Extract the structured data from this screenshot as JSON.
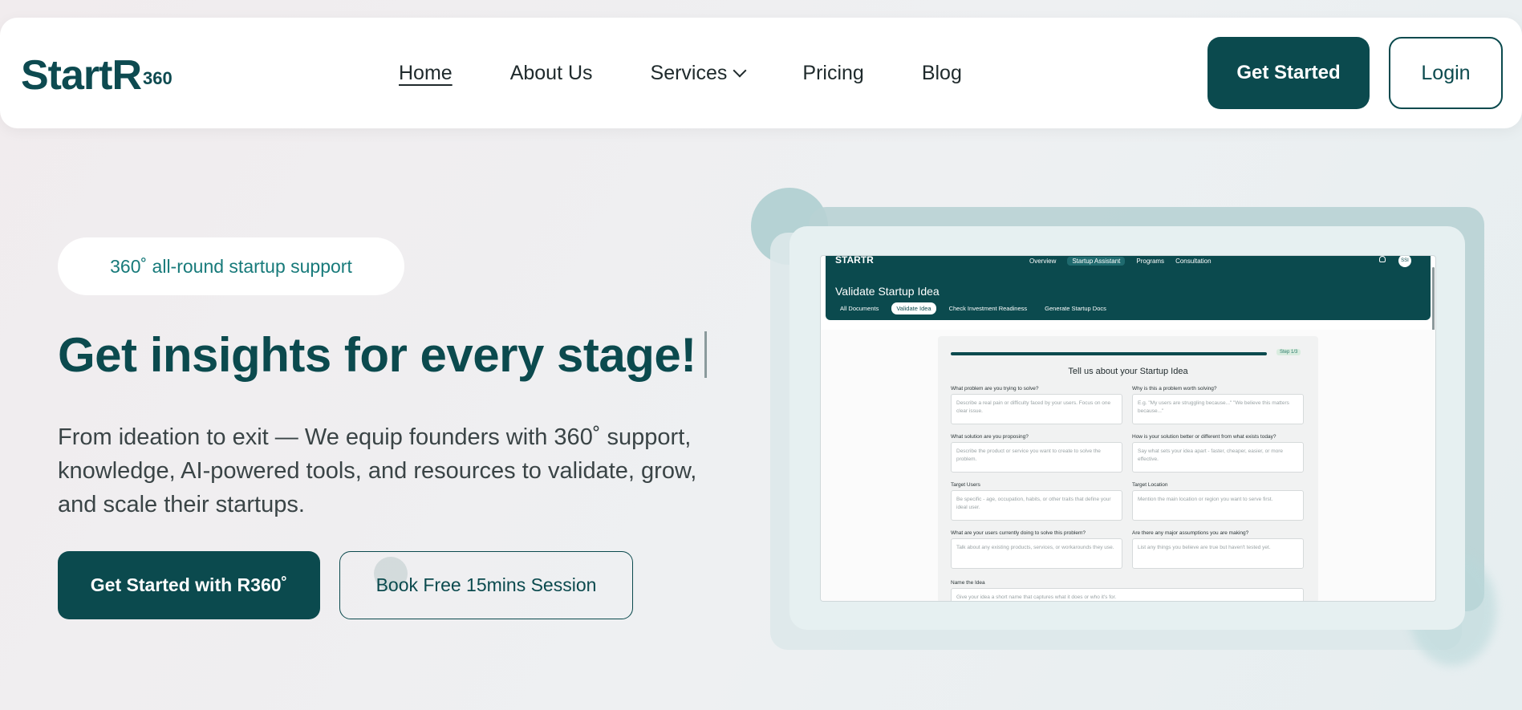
{
  "nav": {
    "logo": "StartR",
    "logo_sup": "360",
    "links": {
      "home": "Home",
      "about": "About Us",
      "services": "Services",
      "pricing": "Pricing",
      "blog": "Blog"
    },
    "get_started": "Get Started",
    "login": "Login"
  },
  "hero": {
    "badge": "360˚ all-round startup support",
    "headline": "Get insights for every stage!",
    "subtext": "From ideation to exit — We equip founders with 360˚ support, knowledge, AI-powered tools, and resources to validate, grow, and scale their startups.",
    "primary_cta": "Get Started with R360˚",
    "secondary_cta": "Book Free 15mins Session"
  },
  "colors": {
    "brand": "#0b4a4e",
    "accent": "#177a7a"
  },
  "preview": {
    "logo": "STARTR",
    "nav": [
      "Overview",
      "Startup Assistant",
      "Programs",
      "Consultation"
    ],
    "active_nav": "Startup Assistant",
    "avatar": "SSI",
    "title": "Validate Startup Idea",
    "tabs": [
      "All Documents",
      "Validate Idea",
      "Check Investment Readiness",
      "Generate Startup Docs"
    ],
    "active_tab": "Validate Idea",
    "step": "Step 1/3",
    "card_title": "Tell us about your Startup Idea",
    "fields": [
      {
        "label": "What problem are you trying to solve?",
        "placeholder": "Describe a real pain or difficulty faced by your users. Focus on one clear issue."
      },
      {
        "label": "Why is this a problem worth solving?",
        "placeholder": "E.g. \"My users are struggling because...\" \"We believe this matters because...\""
      },
      {
        "label": "What solution are you proposing?",
        "placeholder": "Describe the product or service you want to create to solve the problem."
      },
      {
        "label": "How is your solution better or different from what exists today?",
        "placeholder": "Say what sets your idea apart - faster, cheaper, easier, or more effective."
      },
      {
        "label": "Target Users",
        "placeholder": "Be specific - age, occupation, habits, or other traits that define your ideal user."
      },
      {
        "label": "Target Location",
        "placeholder": "Mention the main location or region you want to serve first."
      },
      {
        "label": "What are your users currently doing to solve this problem?",
        "placeholder": "Talk about any existing products, services, or workarounds they use."
      },
      {
        "label": "Are there any major assumptions you are making?",
        "placeholder": "List any things you believe are true but haven't tested yet."
      },
      {
        "label": "Name the Idea",
        "placeholder": "Give your idea a short name that captures what it does or who it's for."
      }
    ]
  }
}
